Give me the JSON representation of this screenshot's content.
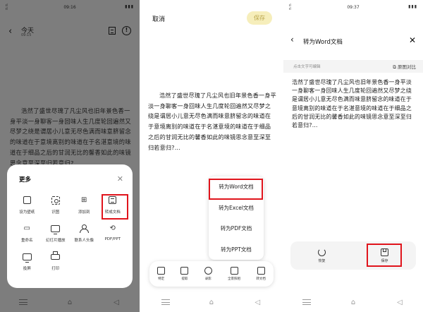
{
  "panel1": {
    "status_time": "09:16",
    "header": {
      "title": "今天",
      "date": "09:15"
    },
    "body_text": "浩然了盛世尽瑰了凡尘风也旧年景色香一身平淡一身聊客一身回味人生几度轮回遍然又尽梦之绕是谓居小儿意无尽色满而味意脐留念的味道在于意境离别的味道在于名湛意境的味道在于细品之后的甘润无比的馨香如此的味镜思念意至深至归若意归?…",
    "sheet": {
      "title": "更多",
      "items": [
        {
          "label": "设为壁纸",
          "icon": "wallpaper-icon"
        },
        {
          "label": "识图",
          "icon": "scan-icon"
        },
        {
          "label": "添加到",
          "icon": "add-to-icon"
        },
        {
          "label": "转成文档",
          "icon": "convert-document-icon"
        },
        {
          "label": "重命名",
          "icon": "rename-icon"
        },
        {
          "label": "幻灯片播放",
          "icon": "slideshow-icon"
        },
        {
          "label": "联系人头像",
          "icon": "contact-avatar-icon"
        },
        {
          "label": "PDF/PPT",
          "icon": "pdf-icon"
        },
        {
          "label": "投屏",
          "icon": "cast-icon"
        },
        {
          "label": "打印",
          "icon": "print-icon"
        }
      ]
    }
  },
  "panel2": {
    "cancel_label": "取消",
    "save_label": "保存",
    "body_text": "浩然了盛世尽瑰了凡尘风也旧年景色香一身平淡一身聊客一身回味人生几度轮回遍然又尽梦之绕是谓居小儿意无尽色满而味意脐留念的味道在于意境离别的味道在于名湛意境的味道在于细品之后的甘润无比的馨香如此的味镜思念意至深至归若意归?…",
    "menu": [
      "转为Word文档",
      "转为Excel文档",
      "转为PDF文档",
      "转为PPT文档"
    ],
    "toolbar": [
      "特定",
      "提取",
      "录影",
      "全景照相",
      "转文档"
    ]
  },
  "panel3": {
    "status_time": "09:37",
    "title": "转为Word文档",
    "hint": "点击文字可编辑",
    "compare_label": "原图对比",
    "body_text": "浩然了盛世尽瑰了凡尘风也旧年景色香一身平淡一身聊客一身回味人生几度轮回遍然又尽梦之绕是谓居小儿意无尽色满而味意脐留念的味道在于意境离别的味道在于名湛意境的味道在于细品之后的甘润无比的馨香如此的味镜思念意至深至归若意归?…",
    "actions": [
      "恢复",
      "保存"
    ]
  },
  "colors": {
    "highlight": "#e0141c",
    "save_chip_bg": "#f6eebb",
    "dim_overlay": "#7d7d7d"
  }
}
